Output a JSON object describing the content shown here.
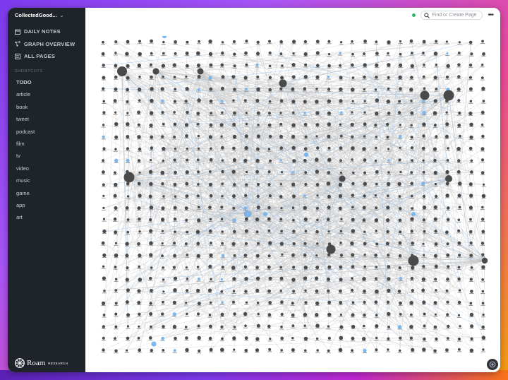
{
  "sidebar": {
    "graph_name": "CollectedGood...",
    "nav": [
      {
        "label": "DAILY NOTES",
        "icon": "calendar-icon"
      },
      {
        "label": "GRAPH OVERVIEW",
        "icon": "graph-icon"
      },
      {
        "label": "ALL PAGES",
        "icon": "list-icon"
      }
    ],
    "shortcuts_title": "SHORTCUTS",
    "shortcuts": [
      "TODO",
      "article",
      "book",
      "tweet",
      "podcast",
      "film",
      "tv",
      "video",
      "music",
      "game",
      "app",
      "art"
    ],
    "logo_text": "Roam",
    "logo_sub": "RESEARCH"
  },
  "topbar": {
    "search_placeholder": "Find or Create Page",
    "sync_color": "#3bb56a"
  },
  "graph": {
    "node_color": "#4a4a4a",
    "highlight_color": "#7cb6ee",
    "edge_color": "#bdbdbd"
  }
}
